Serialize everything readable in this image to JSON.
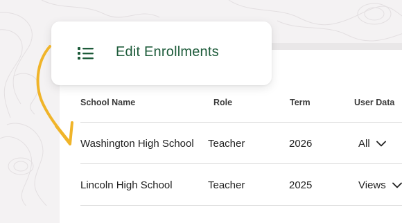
{
  "header": {
    "title": "Edit Enrollments",
    "icon": "list-icon"
  },
  "table": {
    "columns": [
      "School Name",
      "Role",
      "Term",
      "User Data"
    ],
    "rows": [
      {
        "school": "Washington High School",
        "role": "Teacher",
        "term": "2026",
        "user_data": "All"
      },
      {
        "school": "Lincoln High School",
        "role": "Teacher",
        "term": "2025",
        "user_data": "Views"
      }
    ]
  },
  "colors": {
    "accent": "#1d5b3a",
    "arrow": "#f0b429",
    "background": "#f4f2f3"
  }
}
